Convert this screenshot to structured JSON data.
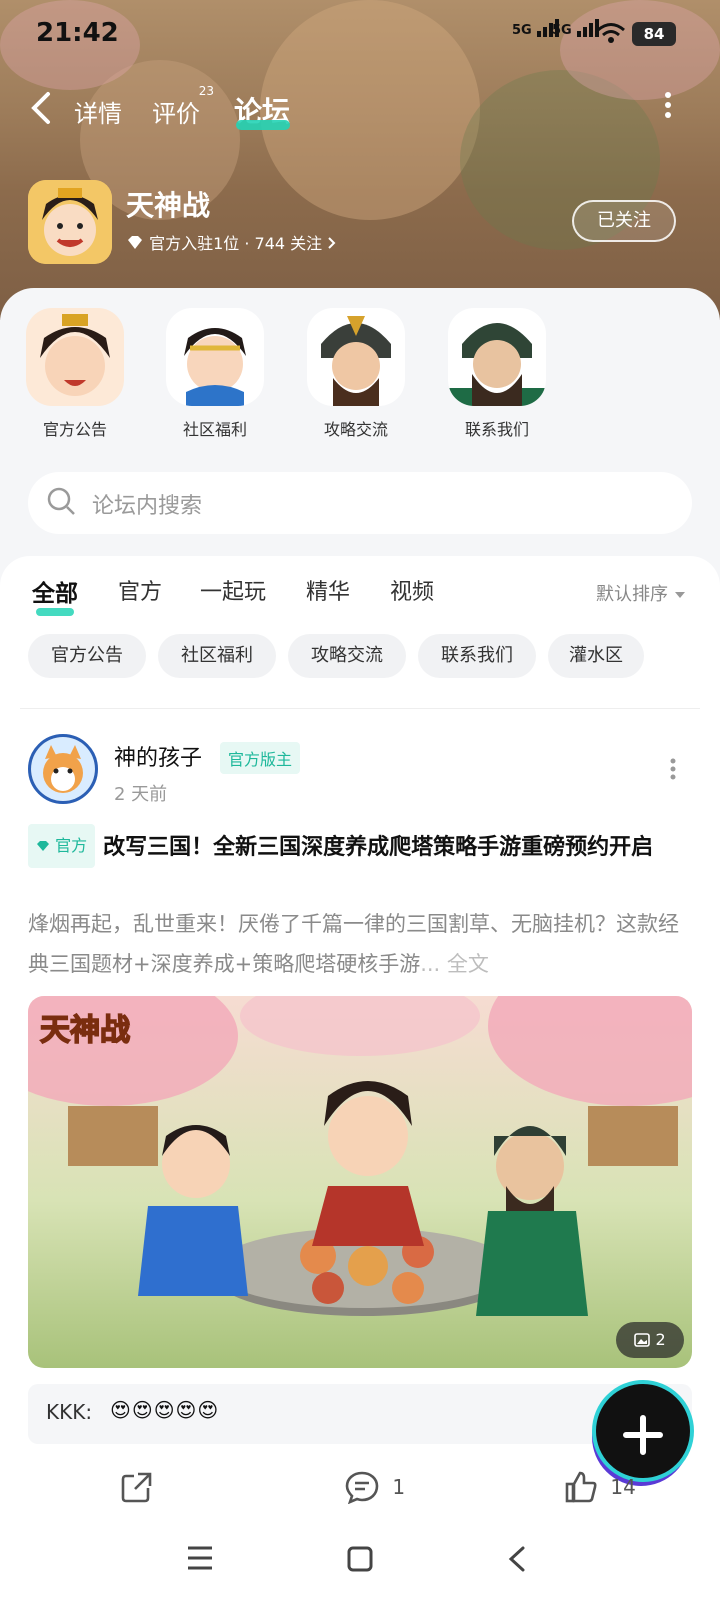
{
  "status_bar": {
    "time": "21:42",
    "signal1": "5G",
    "signal2": "5G",
    "battery": "84"
  },
  "nav": {
    "tabs": [
      {
        "label": "详情"
      },
      {
        "label": "评价",
        "badge": "23"
      },
      {
        "label": "论坛"
      }
    ],
    "active_tab": "论坛"
  },
  "game": {
    "title": "天神战",
    "subtitle": "官方入驻1位 · 744 关注",
    "follow_label": "已关注"
  },
  "shortcuts": [
    {
      "label": "官方公告"
    },
    {
      "label": "社区福利"
    },
    {
      "label": "攻略交流"
    },
    {
      "label": "联系我们"
    }
  ],
  "search": {
    "placeholder": "论坛内搜索"
  },
  "filter_tabs": [
    {
      "label": "全部"
    },
    {
      "label": "官方"
    },
    {
      "label": "一起玩"
    },
    {
      "label": "精华"
    },
    {
      "label": "视频"
    }
  ],
  "sort_label": "默认排序",
  "chips": [
    {
      "label": "官方公告"
    },
    {
      "label": "社区福利"
    },
    {
      "label": "攻略交流"
    },
    {
      "label": "联系我们"
    },
    {
      "label": "灌水区"
    }
  ],
  "post": {
    "author": "神的孩子",
    "author_badge": "官方版主",
    "time": "2 天前",
    "official_badge": "官方",
    "title": "改写三国！全新三国深度养成爬塔策略手游重磅预约开启",
    "excerpt": "烽烟再起，乱世重来！厌倦了千篇一律的三国割草、无脑挂机？这款经典三国题材+深度养成+策略爬塔硬核手游",
    "ellipsis": "... ",
    "full_text_label": "全文",
    "image_logo": "天神战",
    "image_count": "2",
    "comment_author": "KKK:",
    "comment_text": "😍😍😍😍😍",
    "comments": "1",
    "likes": "14"
  },
  "colors": {
    "accent": "#23d3b5",
    "badge_text": "#1eb89b"
  }
}
